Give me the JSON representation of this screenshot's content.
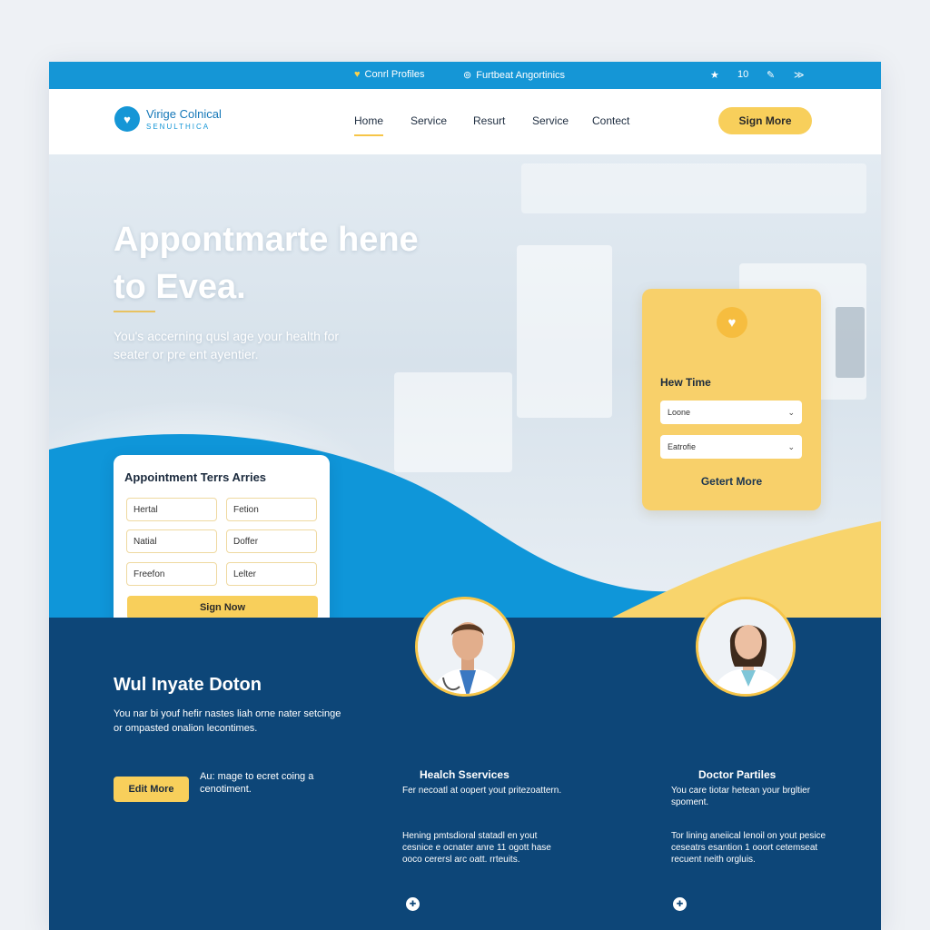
{
  "topbar": {
    "left_label": "Conrl Profiles",
    "mid_label": "Furtbeat Angortinics",
    "right_value": "10"
  },
  "nav": {
    "brand_name": "Virige Colnical",
    "brand_tagline": "SENULTHICA",
    "links": [
      "Home",
      "Service",
      "Resurt",
      "Service",
      "Contect"
    ],
    "cta": "Sign More"
  },
  "hero": {
    "title": "Appontmarte hene to Evea.",
    "subtitle": "You's accerning qusl age your health for seater or pre ent ayentier."
  },
  "appointment_form": {
    "heading": "Appointment Terrs Arries",
    "fields": [
      "Hertal",
      "Fetion",
      "Natial",
      "Doffer",
      "Freefon",
      "Lelter"
    ],
    "submit": "Sign Now"
  },
  "side_card": {
    "heading": "Hew Time",
    "select_1": "Loone",
    "select_2": "Eatrofie",
    "link": "Getert More"
  },
  "section": {
    "title": "Wul Inyate Doton",
    "text": "You nar bi youf hefir nastes liah orne nater setcinge or ompasted onalion lecontimes.",
    "button": "Edit More",
    "note": "Au: mage to ecret coing a cenotiment."
  },
  "columns": [
    {
      "title": "Healch Sservices",
      "text1": "Fer necoatl at oopert yout pritezoattern.",
      "text2": "Hening pmtsdioral statadl en yout cesnice e ocnater anre 11 ogott hase ooco cerersl arc oatt. rrteuits."
    },
    {
      "title": "Doctor Partiles",
      "text1": "You care tiotar hetean your brgltier spoment.",
      "text2": "Tor lining aneiical lenoil on yout pesice ceseatrs esantion 1 ooort cetemseat recuent neith orgluis."
    }
  ],
  "colors": {
    "brand_blue": "#1596d6",
    "navy": "#0d4678",
    "accent_yellow": "#f8cf5b"
  },
  "icons": {
    "topbar": [
      "heart-icon",
      "location-icon",
      "star-icon",
      "edit-icon",
      "share-icon"
    ],
    "logo": "heart-hand-logo-icon",
    "side_card": "care-hand-icon",
    "columns": [
      "doctor-badge-icon",
      "doctor-badge-icon"
    ]
  }
}
